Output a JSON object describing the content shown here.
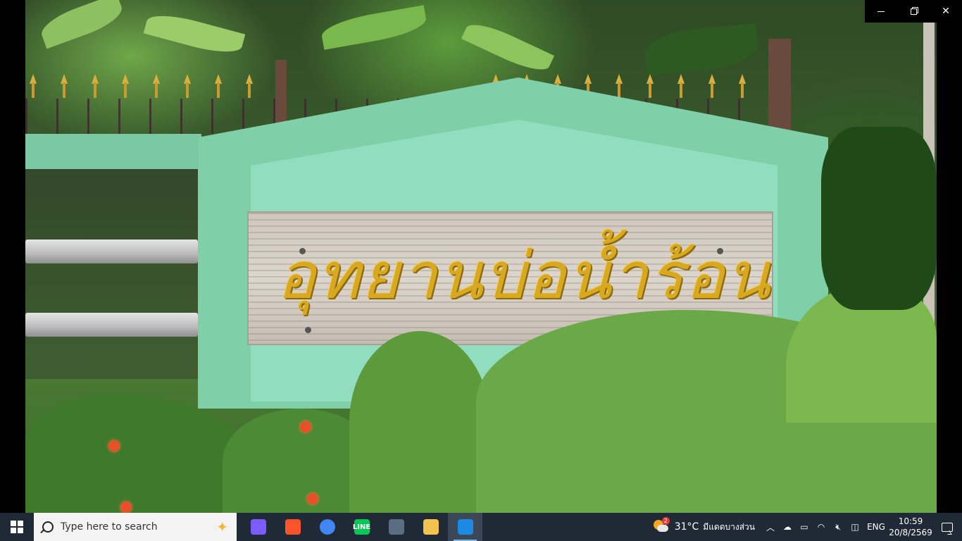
{
  "photo": {
    "sign_text": "อุทยานบ่อน้ำร้อน"
  },
  "window": {
    "minimize_icon": "minimize-icon",
    "restore_icon": "restore-icon",
    "close_icon": "close-icon"
  },
  "taskbar": {
    "search_placeholder": "Type here to search",
    "apps": [
      {
        "name": "copilot",
        "icon": "copilot-icon",
        "color": "#7b5cff"
      },
      {
        "name": "brave",
        "icon": "brave-icon",
        "color": "#fb542b"
      },
      {
        "name": "chrome",
        "icon": "chrome-icon",
        "color": "#4285f4"
      },
      {
        "name": "line",
        "icon": "line-icon",
        "color": "#06c755",
        "label": "LINE"
      },
      {
        "name": "calculator",
        "icon": "calculator-icon",
        "color": "#5a6d82"
      },
      {
        "name": "file-explorer",
        "icon": "folder-icon",
        "color": "#f2c14e"
      },
      {
        "name": "media-player",
        "icon": "media-player-icon",
        "color": "#1e88e5"
      }
    ],
    "weather": {
      "temperature": "31°C",
      "condition": "มีแดดบางส่วน",
      "badge": "2"
    },
    "language": "ENG",
    "time": "10:59",
    "date": "20/8/2569"
  }
}
